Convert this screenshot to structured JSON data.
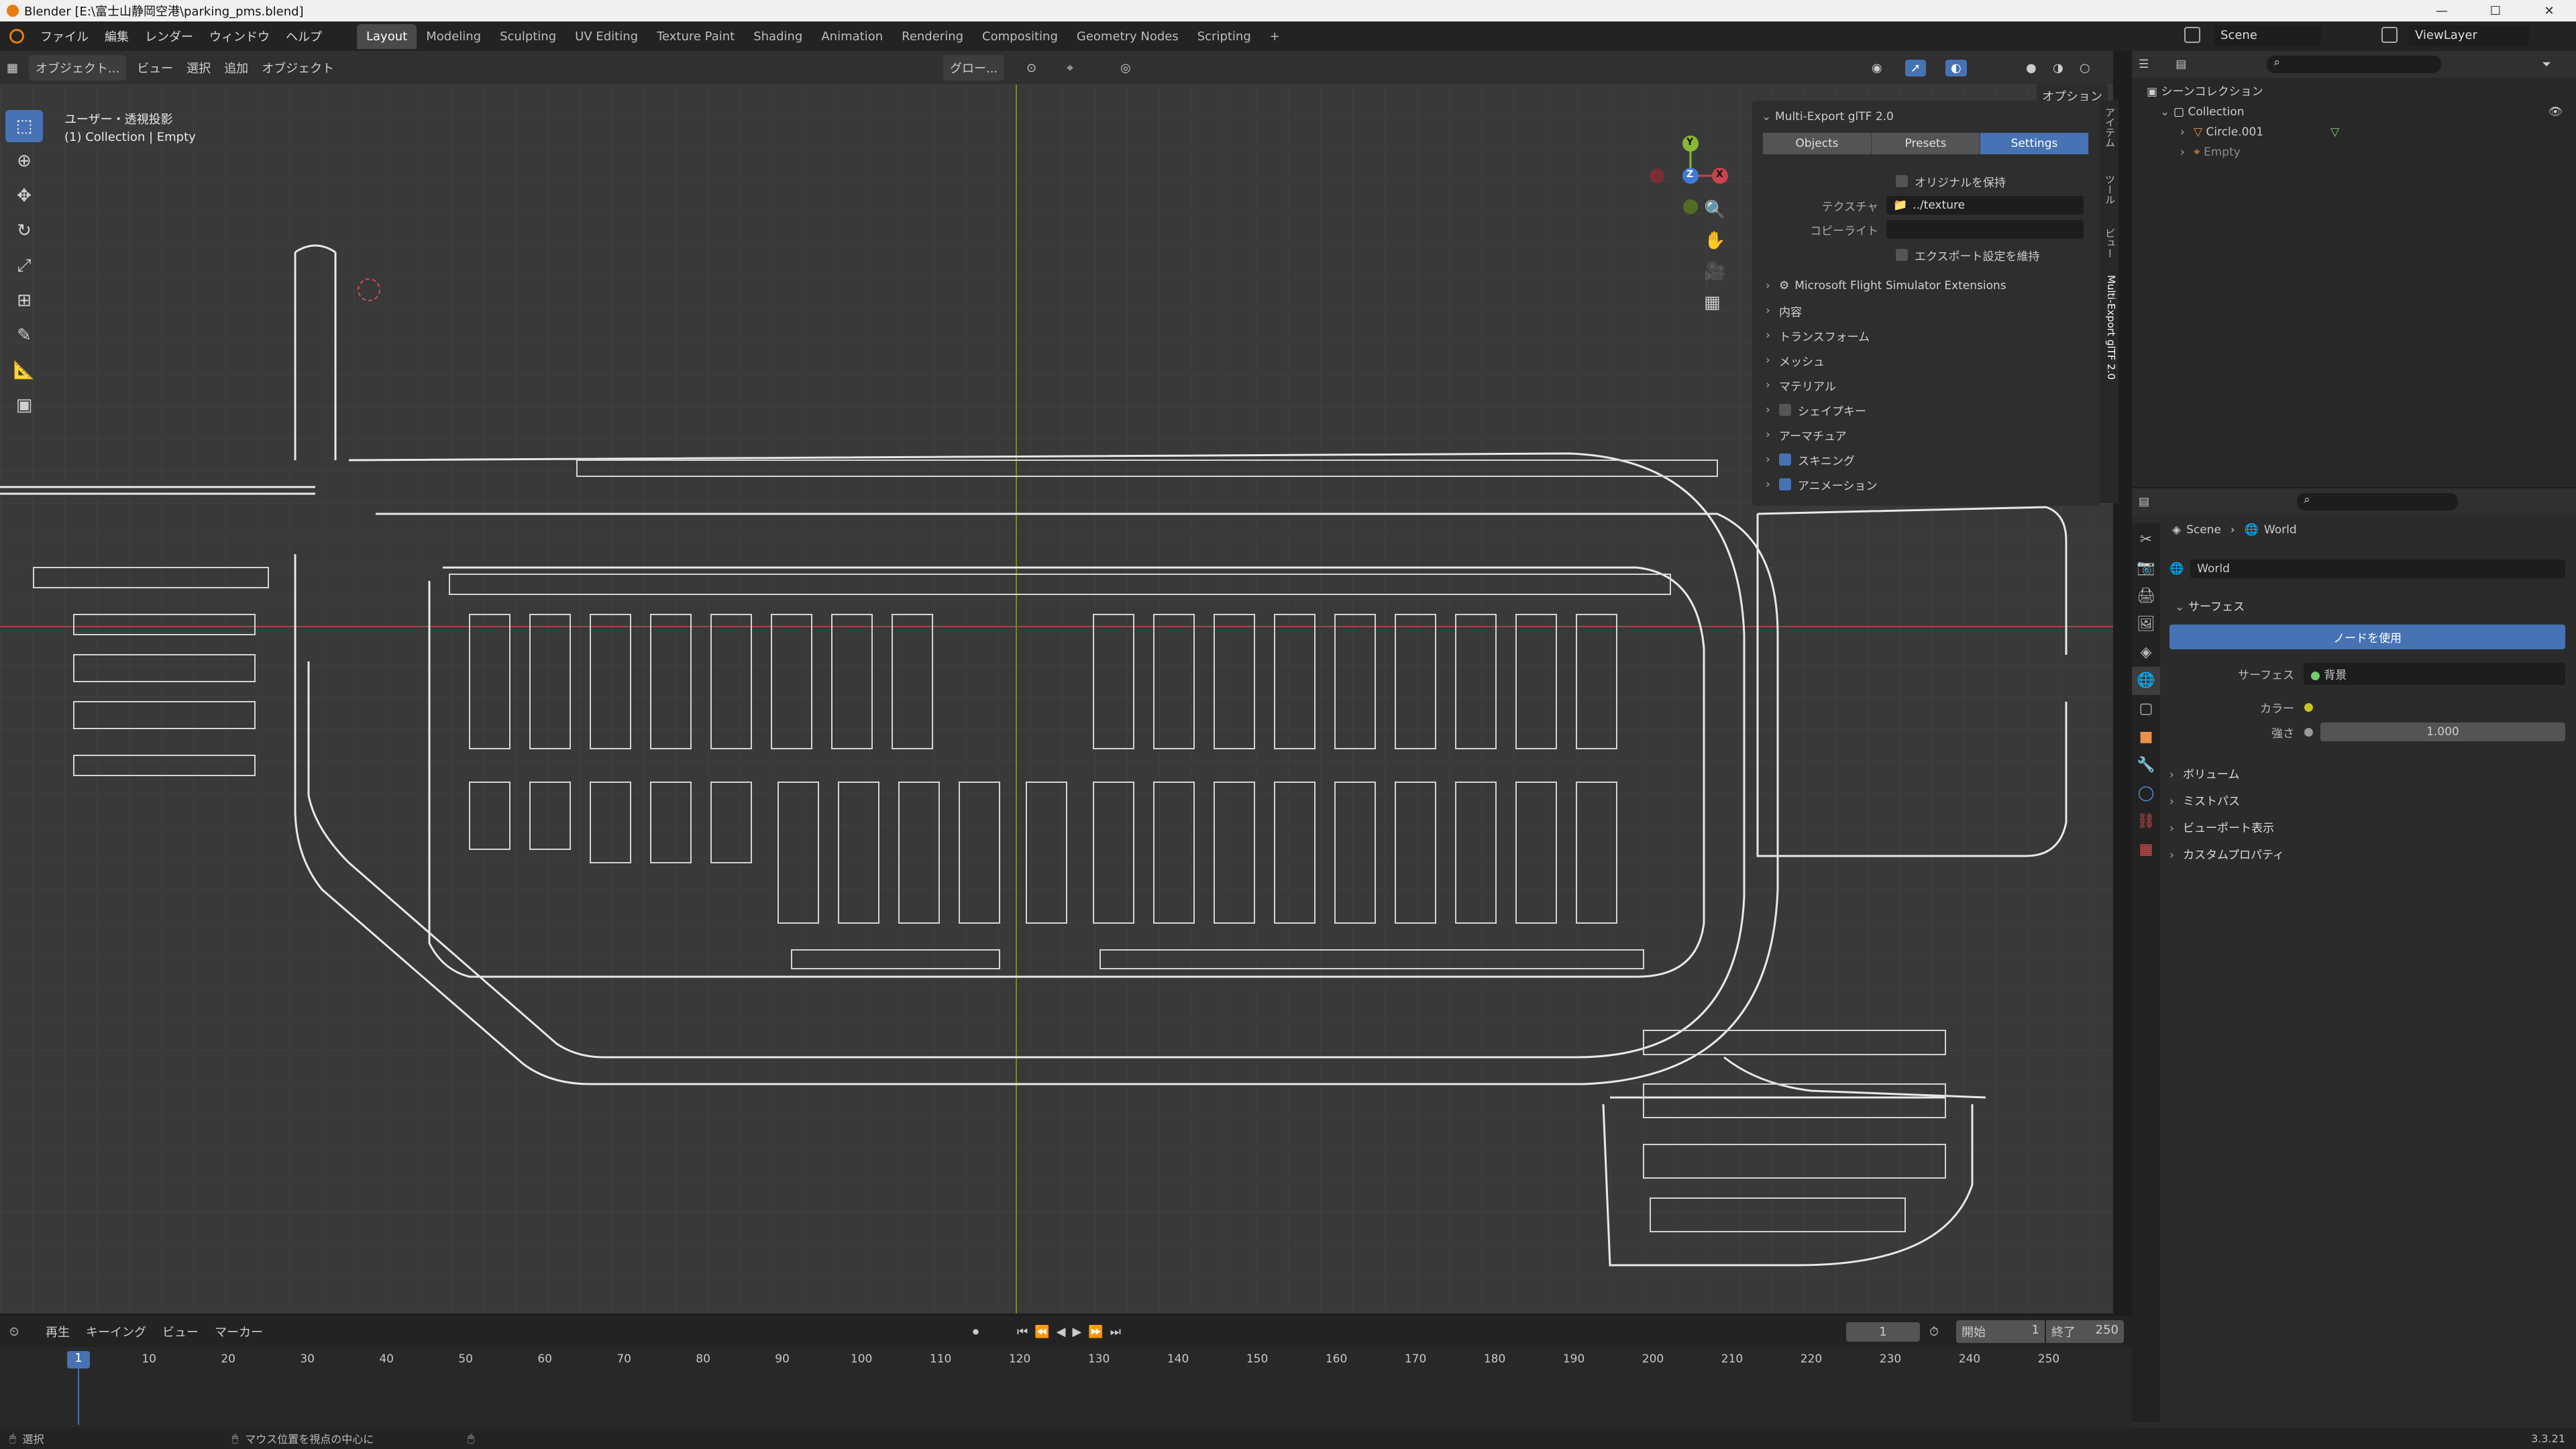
{
  "window": {
    "title": "Blender [E:\\富士山静岡空港\\parking_pms.blend]",
    "controls": [
      "—",
      "☐",
      "✕"
    ]
  },
  "menubar": {
    "menus": [
      "ファイル",
      "編集",
      "レンダー",
      "ウィンドウ",
      "ヘルプ"
    ],
    "workspaces": [
      "Layout",
      "Modeling",
      "Sculpting",
      "UV Editing",
      "Texture Paint",
      "Shading",
      "Animation",
      "Rendering",
      "Compositing",
      "Geometry Nodes",
      "Scripting"
    ],
    "active_workspace": "Layout",
    "add_tab": "+",
    "scene_label": "Scene",
    "viewlayer_label": "ViewLayer"
  },
  "viewport_header": {
    "mode": "オブジェクト...",
    "menus": [
      "ビュー",
      "選択",
      "追加",
      "オブジェクト"
    ],
    "orientation": "グロー...",
    "options": "オプション"
  },
  "viewport": {
    "view_name": "ユーザー・透視投影",
    "context": "(1) Collection | Empty",
    "gizmo": {
      "y": "Y",
      "z": "Z",
      "x": "X"
    },
    "colors": {
      "x_axis": "#c9434c",
      "y_axis": "#8ab733",
      "z_axis": "#3f7bd4"
    }
  },
  "addon_panel": {
    "title": "Multi-Export glTF 2.0",
    "tabs": [
      "Objects",
      "Presets",
      "Settings"
    ],
    "active_tab": "Settings",
    "keep_original": "オリジナルを保持",
    "texture_label": "テクスチャ",
    "texture_value": "../texture",
    "copyright_label": "コピーライト",
    "copyright_value": "",
    "keep_export_settings": "エクスポート設定を維持",
    "sections": [
      {
        "label": "Microsoft Flight Simulator Extensions",
        "checkbox": null
      },
      {
        "label": "内容",
        "checkbox": null
      },
      {
        "label": "トランスフォーム",
        "checkbox": null
      },
      {
        "label": "メッシュ",
        "checkbox": null
      },
      {
        "label": "マテリアル",
        "checkbox": null
      },
      {
        "label": "シェイプキー",
        "checkbox": "off"
      },
      {
        "label": "アーマチュア",
        "checkbox": null
      },
      {
        "label": "スキニング",
        "checkbox": "on"
      },
      {
        "label": "アニメーション",
        "checkbox": "on"
      }
    ],
    "side_tabs": [
      "アイテム",
      "ツール",
      "ビュー",
      "Multi-Export glTF 2.0"
    ]
  },
  "outliner": {
    "root": "シーンコレクション",
    "collection": "Collection",
    "objects": [
      "Circle.001",
      "Empty"
    ]
  },
  "properties": {
    "breadcrumb": [
      "Scene",
      "World"
    ],
    "world_name": "World",
    "surface_header": "サーフェス",
    "use_nodes": "ノードを使用",
    "surface_label": "サーフェス",
    "surface_value": "背景",
    "color_label": "カラー",
    "strength_label": "強さ",
    "strength_value": "1.000",
    "collapsed": [
      "ボリューム",
      "ミストパス",
      "ビューポート表示",
      "カスタムプロパティ"
    ]
  },
  "timeline": {
    "menus": [
      "再生",
      "キーイング",
      "ビュー",
      "マーカー"
    ],
    "current_frame": "1",
    "start_label": "開始",
    "start_value": "1",
    "end_label": "終了",
    "end_value": "250",
    "ruler": [
      "1",
      "10",
      "20",
      "30",
      "40",
      "50",
      "60",
      "70",
      "80",
      "90",
      "100",
      "110",
      "120",
      "130",
      "140",
      "150",
      "160",
      "170",
      "180",
      "190",
      "200",
      "210",
      "220",
      "230",
      "240",
      "250"
    ]
  },
  "statusbar": {
    "select": "選択",
    "hint": "マウス位置を視点の中心に",
    "version": "3.3.21"
  }
}
